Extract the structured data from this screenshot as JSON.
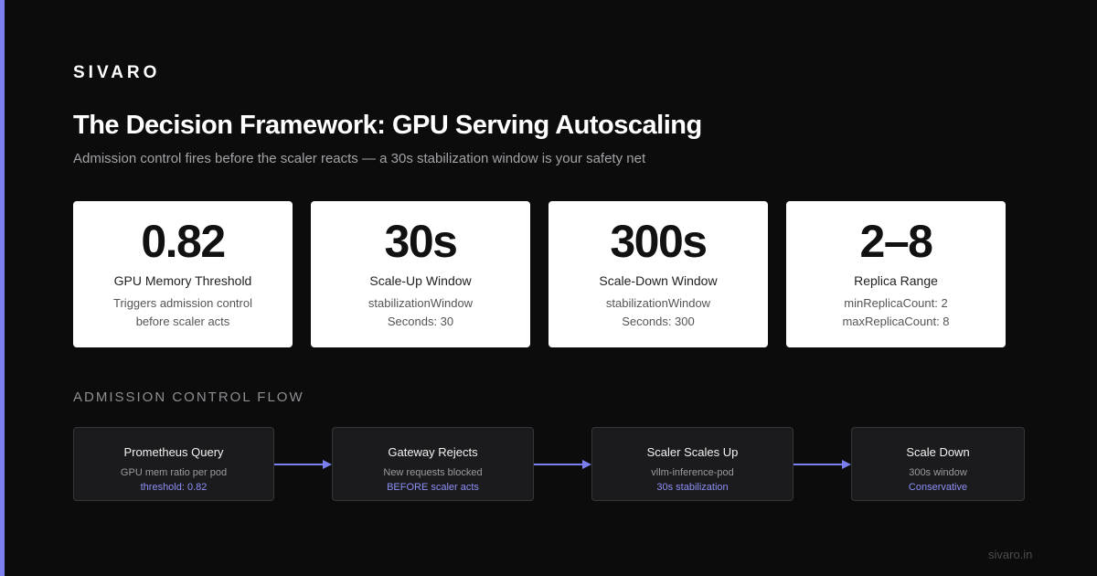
{
  "brand": "SIVARO",
  "title": "The Decision Framework: GPU Serving Autoscaling",
  "subtitle": "Admission control fires before the scaler reacts — a 30s stabilization window is your safety net",
  "stats": [
    {
      "value": "0.82",
      "label": "GPU Memory Threshold",
      "desc_line1": "Triggers admission control",
      "desc_line2": "before scaler acts"
    },
    {
      "value": "30s",
      "label": "Scale-Up Window",
      "desc_line1": "stabilizationWindow",
      "desc_line2": "Seconds: 30"
    },
    {
      "value": "300s",
      "label": "Scale-Down Window",
      "desc_line1": "stabilizationWindow",
      "desc_line2": "Seconds: 300"
    },
    {
      "value": "2–8",
      "label": "Replica Range",
      "desc_line1": "minReplicaCount: 2",
      "desc_line2": "maxReplicaCount: 8"
    }
  ],
  "flow": {
    "section_label": "ADMISSION CONTROL FLOW",
    "nodes": [
      {
        "title": "Prometheus Query",
        "desc": "GPU mem ratio per pod",
        "accent": "threshold: 0.82"
      },
      {
        "title": "Gateway Rejects",
        "desc": "New requests blocked",
        "accent": "BEFORE scaler acts"
      },
      {
        "title": "Scaler Scales Up",
        "desc": "vllm-inference-pod",
        "accent": "30s stabilization"
      },
      {
        "title": "Scale Down",
        "desc": "300s window",
        "accent": "Conservative"
      }
    ]
  },
  "footer": "sivaro.in",
  "colors": {
    "background": "#0c0c0c",
    "accent": "#7b7ff0",
    "card": "#ffffff",
    "node_bg": "#1b1b1d",
    "node_border": "#36363a",
    "node_accent_text": "#8c8ff5"
  }
}
